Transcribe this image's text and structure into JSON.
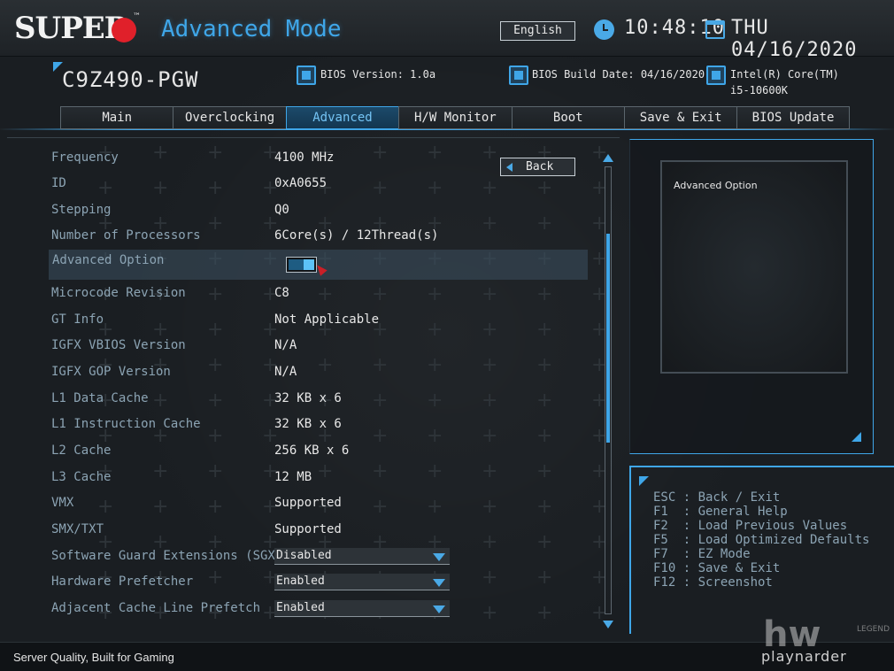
{
  "header": {
    "brand": "SUPER",
    "brand_tm": "™",
    "mode_title": "Advanced Mode",
    "language": "English",
    "time": "10:48:10",
    "date": "THU 04/16/2020"
  },
  "system_info": {
    "board": "C9Z490-PGW",
    "bios_version": "BIOS Version: 1.0a",
    "bios_build_date": "BIOS Build Date: 04/16/2020",
    "cpu_line1": "Intel(R) Core(TM)",
    "cpu_line2": "i5-10600K"
  },
  "tabs": [
    {
      "label": "Main",
      "active": false
    },
    {
      "label": "Overclocking",
      "active": false
    },
    {
      "label": "Advanced",
      "active": true
    },
    {
      "label": "H/W Monitor",
      "active": false
    },
    {
      "label": "Boot",
      "active": false
    },
    {
      "label": "Save & Exit",
      "active": false
    },
    {
      "label": "BIOS Update",
      "active": false
    }
  ],
  "back_button": "Back",
  "settings": [
    {
      "label": "Frequency",
      "value": "4100 MHz"
    },
    {
      "label": "ID",
      "value": "0xA0655"
    },
    {
      "label": "Stepping",
      "value": "Q0"
    },
    {
      "label": "Number of Processors",
      "value": "6Core(s) / 12Thread(s)"
    },
    {
      "label": "Advanced Option",
      "value": "On"
    },
    {
      "label": "Microcode Revision",
      "value": "C8"
    },
    {
      "label": "GT Info",
      "value": "Not Applicable"
    },
    {
      "label": "IGFX VBIOS Version",
      "value": "N/A"
    },
    {
      "label": "IGFX GOP Version",
      "value": "N/A"
    },
    {
      "label": "L1 Data Cache",
      "value": "32 KB x 6"
    },
    {
      "label": "L1 Instruction Cache",
      "value": "32 KB x 6"
    },
    {
      "label": "L2 Cache",
      "value": "256 KB x 6"
    },
    {
      "label": "L3 Cache",
      "value": "12 MB"
    },
    {
      "label": "VMX",
      "value": "Supported"
    },
    {
      "label": "SMX/TXT",
      "value": "Supported"
    },
    {
      "label": "Software Guard Extensions (SGX)",
      "value": "Disabled"
    },
    {
      "label": "Hardware Prefetcher",
      "value": "Enabled"
    },
    {
      "label": "Adjacent Cache Line Prefetch",
      "value": "Enabled"
    }
  ],
  "help": {
    "title": "Advanced Option"
  },
  "key_help": [
    "ESC : Back / Exit",
    "F1  : General Help",
    "F2  : Load Previous Values",
    "F5  : Load Optimized Defaults",
    "F7  : EZ Mode",
    "F10 : Save & Exit",
    "F12 : Screenshot"
  ],
  "footer": {
    "tagline": "Server Quality, Built for Gaming",
    "watermark": "playnarder",
    "watermark_big": "hw",
    "watermark_small": "LEGEND"
  },
  "colors": {
    "accent": "#3fa6e8",
    "brand_red": "#e0202a",
    "label": "#8ca4b4"
  }
}
